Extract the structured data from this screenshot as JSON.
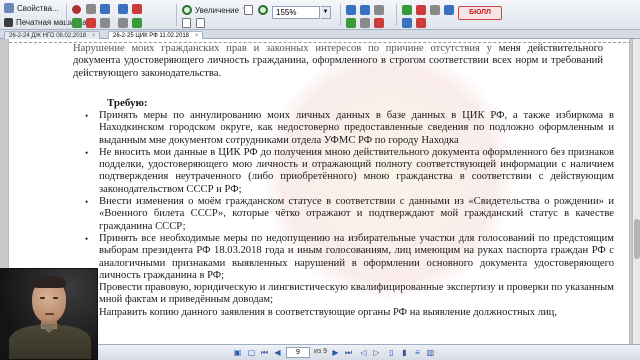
{
  "toolbar": {
    "properties_label": "Свойства...",
    "typewriter_label": "Печатная машинка",
    "zoom_label": "Увеличение",
    "zoom_value": "155%",
    "stamp_label": "БЮЛЛ"
  },
  "tabs": [
    {
      "label": "26-2-24 ДЖ НГО 06.02.2018",
      "active": false
    },
    {
      "label": "26-2-25 ЦИК РФ 11.02.2018",
      "active": true
    }
  ],
  "document": {
    "top_para_faded": "Нарушение моих гражданских прав и законных интересов по причине отсутствия у",
    "top_para": "меня действительного документа удостоверяющего личность гражданина, оформленного в строгом соответствии всех норм и требований действующего законодательства.",
    "requirements_heading": "Требую:",
    "requirements": [
      "Принять меры по аннулированию моих личных данных в базе данных в ЦИК РФ, а также избиркома в Находкинском городском округе, как недостоверно предоставленные сведения по подложно оформленным и выданным мне документом сотрудниками отдела УФМС РФ по городу Находка",
      "Не вносить мои данные в ЦИК РФ до получения мною действительного документа оформленного без признаков подделки, удостоверяющего мою личность и отражающий полноту соответствующей информации с наличием подтверждения неутраченного (либо приобретённого) мною гражданства в соответствии с действующим законодательством СССР и РФ;",
      "Внести изменения о моём гражданском статусе в соответствии с данными из «Свидетельства о рождении» и «Военного билета СССР», которые чётко отражают и подтверждают мой гражданский статус в качестве гражданина СССР;",
      "Принять все необходимые меры по недопущению на избирательные участки для голосований по предстоящим выборам президента РФ 18.03.2018 года и иным голосованиям, лиц имеющим на руках паспорта граждан РФ с аналогичными признаками выявленных нарушений в оформлении основного документа удостоверяющего личность гражданина в РФ;",
      "Провести правовую, юридическую и лингвистическую квалифицированные экспертизу и проверки по указанным мной фактам и приведённым доводам;",
      "Направить копию данного заявления в соответствующие органы РФ на выявление должностных лиц,"
    ]
  },
  "navigation": {
    "current_page": "9",
    "total_pages": "из 9"
  }
}
